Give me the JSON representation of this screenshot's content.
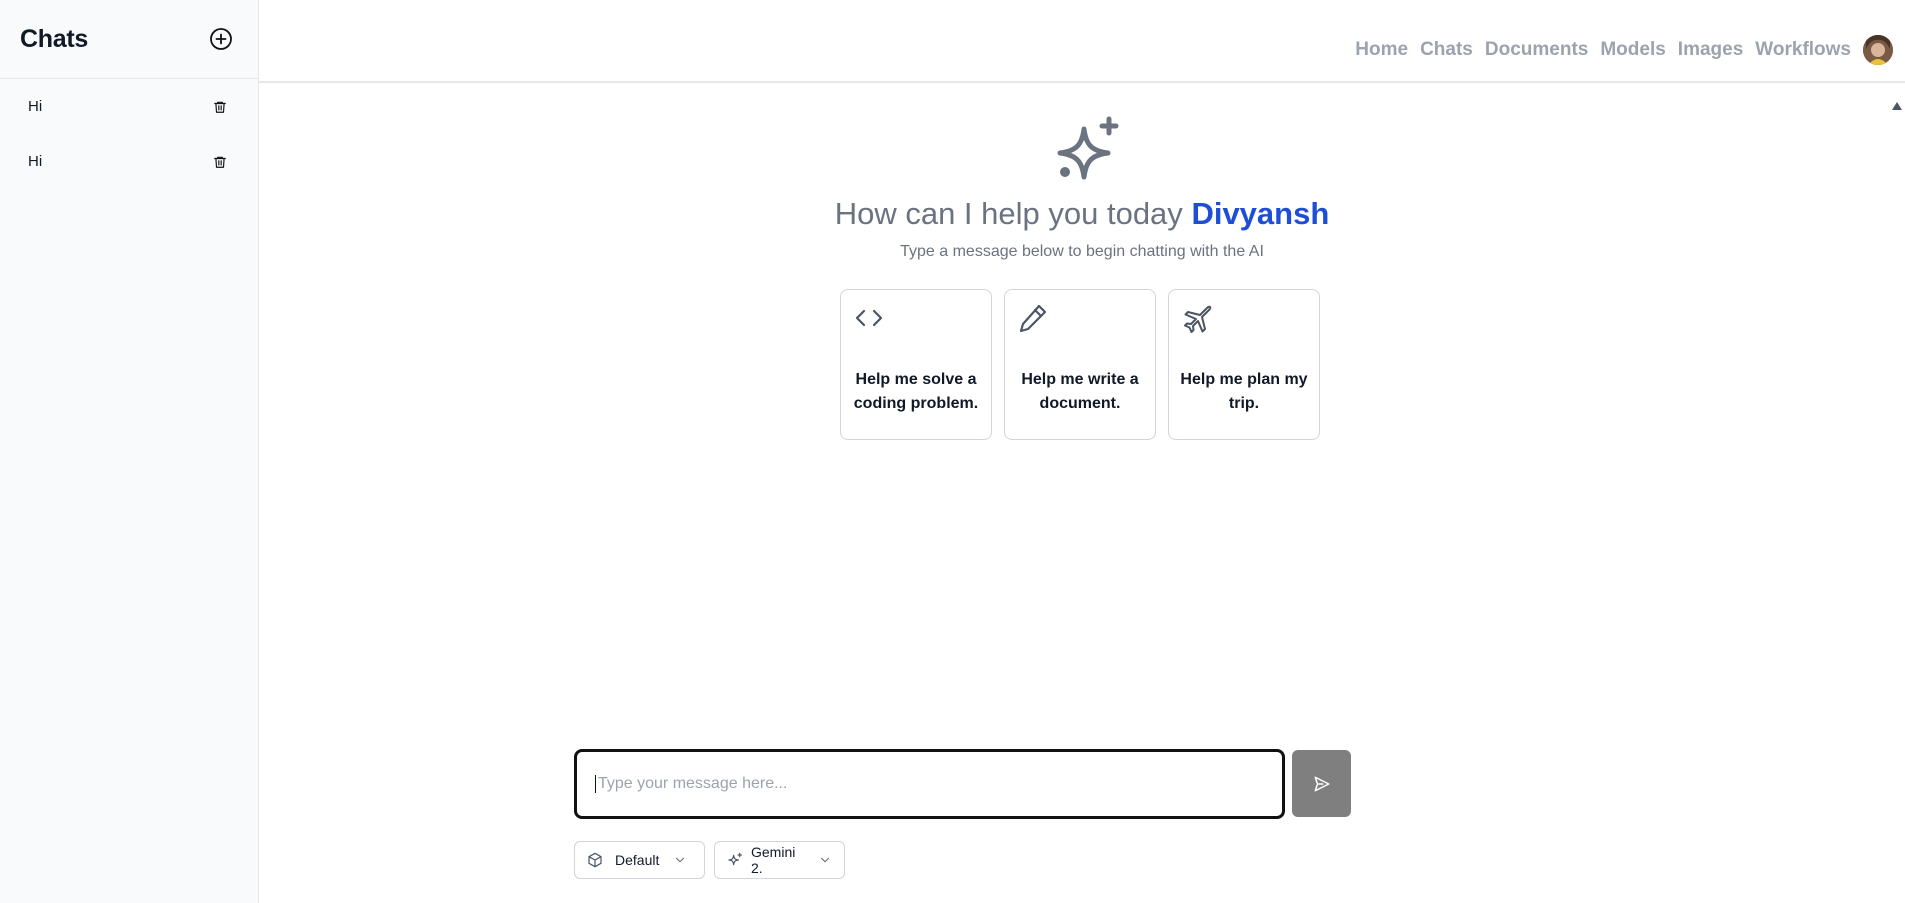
{
  "sidebar": {
    "title": "Chats",
    "new_chat_icon": "plus-circle-icon",
    "chats": [
      {
        "label": "Hi",
        "delete_icon": "trash-icon"
      },
      {
        "label": "Hi",
        "delete_icon": "trash-icon"
      }
    ]
  },
  "nav": {
    "links": [
      "Home",
      "Chats",
      "Documents",
      "Models",
      "Images",
      "Workflows"
    ],
    "avatar_icon": "user-avatar"
  },
  "hero": {
    "icon": "sparkles-icon",
    "title_prefix": "How can I help you today",
    "user_name": "Divyansh",
    "subtitle": "Type a message below to begin chatting with the AI"
  },
  "cards": [
    {
      "icon": "code-icon",
      "text": "Help me solve a coding problem."
    },
    {
      "icon": "pencil-icon",
      "text": "Help me write a document."
    },
    {
      "icon": "plane-icon",
      "text": "Help me plan my trip."
    }
  ],
  "composer": {
    "placeholder": "Type your message here...",
    "value": "",
    "send_icon": "send-icon"
  },
  "selectors": {
    "preset": {
      "icon": "cube-icon",
      "value": "Default"
    },
    "model": {
      "icon": "sparkles-icon",
      "value": "Gemini 2."
    }
  },
  "colors": {
    "accent": "#1d4ed8",
    "muted_text": "#6b7280",
    "nav_text": "#9ca3af",
    "send_button": "#7f7f7f"
  }
}
